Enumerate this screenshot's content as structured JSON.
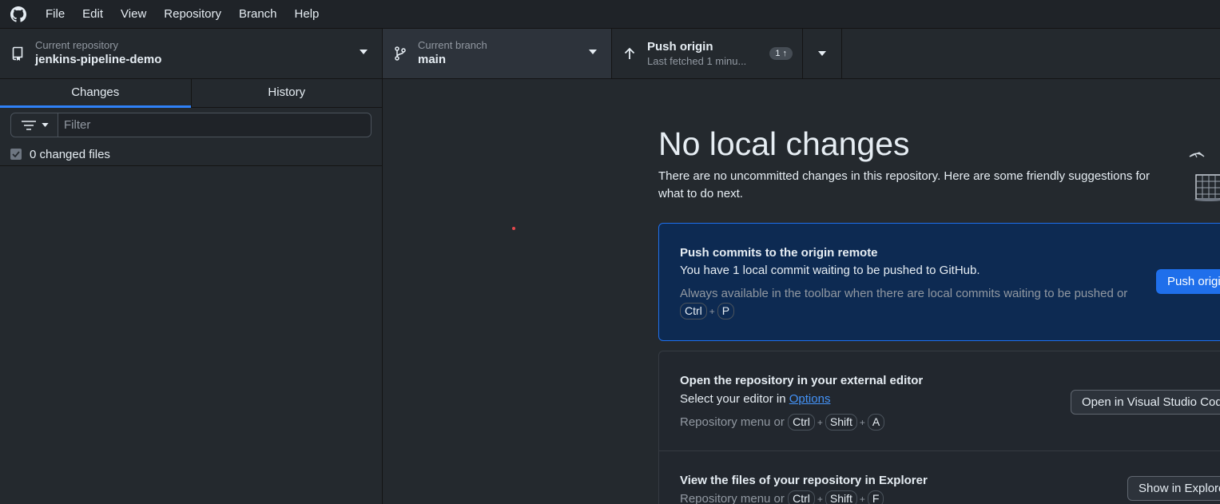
{
  "menu": [
    "File",
    "Edit",
    "View",
    "Repository",
    "Branch",
    "Help"
  ],
  "toolbar": {
    "repo_label": "Current repository",
    "repo_name": "jenkins-pipeline-demo",
    "branch_label": "Current branch",
    "branch_name": "main",
    "push_title": "Push origin",
    "push_subtitle": "Last fetched 1 minu...",
    "push_count": "1 ↑"
  },
  "sidebar": {
    "tabs": [
      "Changes",
      "History"
    ],
    "active_tab": "Changes",
    "filter_placeholder": "Filter",
    "changed_files": "0 changed files"
  },
  "main": {
    "headline": "No local changes",
    "subtext": "There are no uncommitted changes in this repository. Here are some friendly suggestions for what to do next.",
    "push_card": {
      "title": "Push commits to the origin remote",
      "desc": "You have 1 local commit waiting to be pushed to GitHub.",
      "hint": "Always available in the toolbar when there are local commits waiting to be pushed or",
      "shortcut": [
        "Ctrl",
        "P"
      ],
      "button": "Push origin"
    },
    "editor_card": {
      "title": "Open the repository in your external editor",
      "desc_prefix": "Select your editor in ",
      "desc_link": "Options",
      "hint": "Repository menu or",
      "shortcut": [
        "Ctrl",
        "Shift",
        "A"
      ],
      "button": "Open in Visual Studio Code"
    },
    "explorer_card": {
      "title": "View the files of your repository in Explorer",
      "hint": "Repository menu or",
      "shortcut": [
        "Ctrl",
        "Shift",
        "F"
      ],
      "button": "Show in Explorer"
    }
  },
  "colors": {
    "accent": "#1f6feb",
    "background": "#24292e",
    "primary_card": "#0d2a52"
  }
}
